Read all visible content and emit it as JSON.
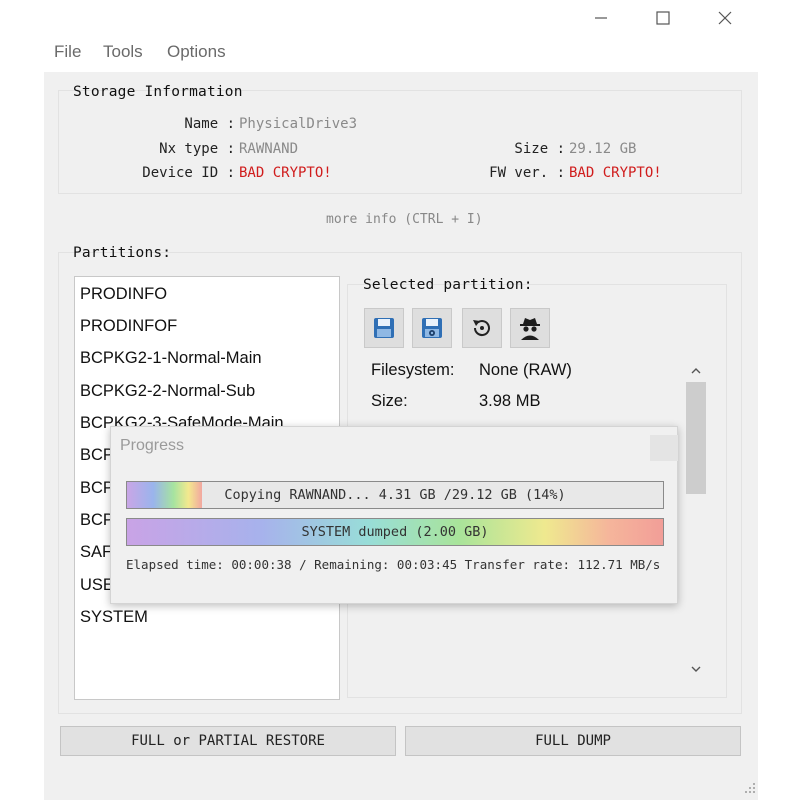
{
  "menu": {
    "file": "File",
    "tools": "Tools",
    "options": "Options"
  },
  "storage": {
    "title": "Storage Information",
    "name_label": "Name :",
    "name_value": "PhysicalDrive3",
    "nxtype_label": "Nx type :",
    "nxtype_value": "RAWNAND",
    "deviceid_label": "Device ID :",
    "deviceid_value": "BAD CRYPTO!",
    "size_label": "Size :",
    "size_value": "29.12 GB",
    "fwver_label": "FW ver. :",
    "fwver_value": "BAD CRYPTO!"
  },
  "more_info": "more info (CTRL + I)",
  "partitions": {
    "title": "Partitions:",
    "items": [
      "PRODINFO",
      "PRODINFOF",
      "BCPKG2-1-Normal-Main",
      "BCPKG2-2-Normal-Sub",
      "BCPKG2-3-SafeMode-Main",
      "BCP",
      "BCP",
      "BCP",
      "SAF",
      "USE",
      "SYSTEM"
    ]
  },
  "selected": {
    "title": "Selected partition:",
    "icons": [
      "save-icon",
      "save-settings-icon",
      "restore-icon",
      "spy-icon"
    ],
    "filesystem_label": "Filesystem:",
    "filesystem_value": "None (RAW)",
    "size_label": "Size:",
    "size_value": "3.98 MB"
  },
  "buttons": {
    "restore": "FULL or PARTIAL RESTORE",
    "dump": "FULL DUMP"
  },
  "progress": {
    "title": "Progress",
    "bar1_text": "Copying RAWNAND... 4.31 GB /29.12 GB (14%)",
    "bar1_fraction": 0.14,
    "bar2_text": "SYSTEM dumped (2.00 GB)",
    "bar2_fraction": 1.0,
    "stats": "Elapsed time: 00:00:38 / Remaining: 00:03:45  Transfer rate: 112.71 MB/s"
  }
}
